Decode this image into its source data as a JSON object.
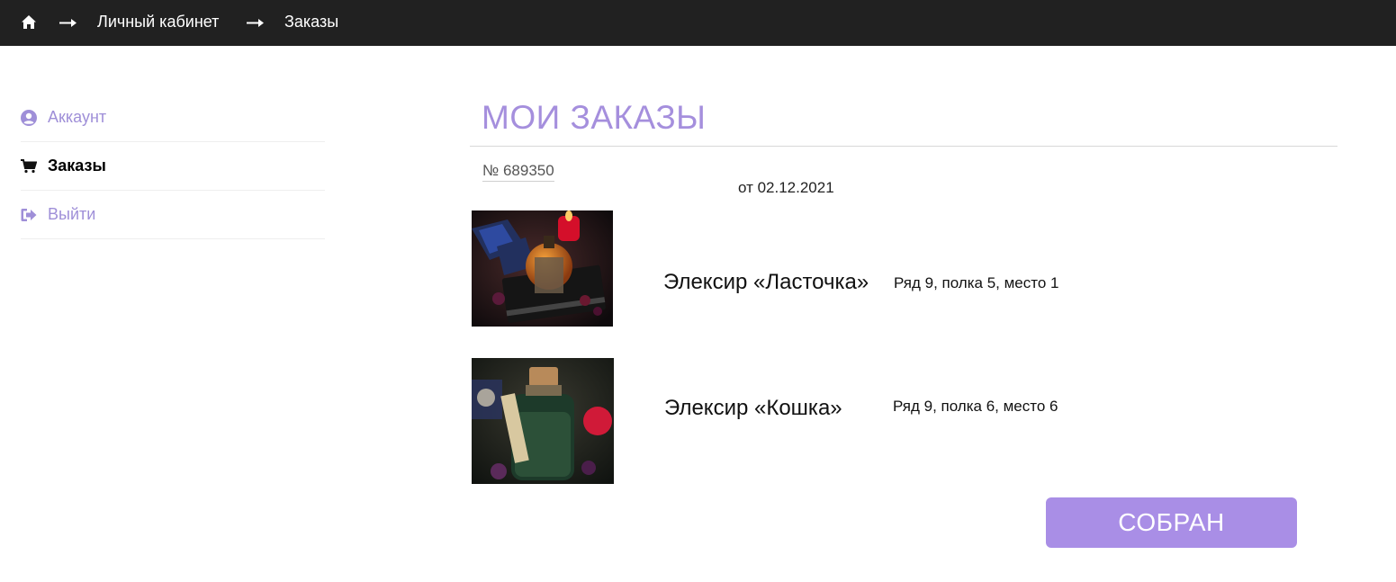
{
  "breadcrumb": {
    "items": [
      "Личный кабинет",
      "Заказы"
    ]
  },
  "sidebar": {
    "items": [
      {
        "label": "Аккаунт",
        "icon": "user-circle-icon"
      },
      {
        "label": "Заказы",
        "icon": "cart-icon"
      },
      {
        "label": "Выйти",
        "icon": "sign-out-icon"
      }
    ]
  },
  "main": {
    "title": "МОИ ЗАКАЗЫ",
    "order": {
      "number": "№ 689350",
      "date": "от 02.12.2021",
      "items": [
        {
          "name": "Элексир «Ласточка»",
          "location": "Ряд 9, полка 5, место 1"
        },
        {
          "name": "Элексир «Кошка»",
          "location": "Ряд 9, полка 6, место 6"
        }
      ]
    },
    "status_button": "СОБРАН"
  },
  "colors": {
    "topbar": "#212121",
    "accent": "#a58fdd",
    "button": "#a98ee6"
  }
}
